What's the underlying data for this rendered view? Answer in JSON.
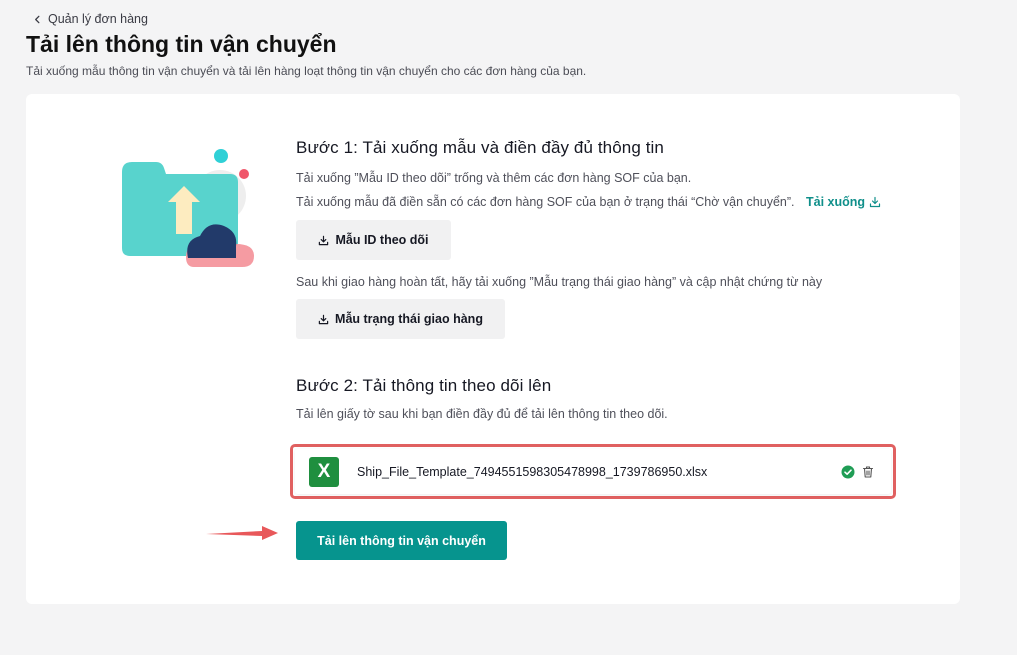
{
  "breadcrumb": {
    "label": "Quản lý đơn hàng"
  },
  "page": {
    "title": "Tải lên thông tin vận chuyển",
    "subtitle": "Tải xuống mẫu thông tin vận chuyển và tải lên hàng loạt thông tin vận chuyển cho các đơn hàng của bạn."
  },
  "step1": {
    "title": "Bước 1: Tải xuống mẫu và điền đầy đủ thông tin",
    "desc1": "Tải xuống ”Mẫu ID theo dõi” trống và thêm các đơn hàng SOF của bạn.",
    "desc2": "Tải xuống mẫu đã điền sẵn có các đơn hàng SOF của bạn ở trạng thái “Chờ vận chuyển”.",
    "download_link": "Tải xuống",
    "tracking_template_button": "Mẫu ID theo dõi",
    "desc3": "Sau khi giao hàng hoàn tất, hãy tải xuống ”Mẫu trạng thái giao hàng” và cập nhật chứng từ này",
    "delivery_template_button": "Mẫu trạng thái giao hàng"
  },
  "step2": {
    "title": "Bước 2: Tải thông tin theo dõi lên",
    "desc": "Tải lên giấy tờ sau khi bạn điền đầy đủ để tải lên thông tin theo dõi.",
    "file": {
      "icon_letter": "X",
      "name": "Ship_File_Template_7494551598305478998_1739786950.xlsx",
      "status": "uploaded"
    },
    "upload_button": "Tải lên thông tin vận chuyển"
  },
  "colors": {
    "accent": "#06948e",
    "link": "#0f8f8a",
    "highlight_border": "#e06060",
    "success": "#1f9d55",
    "excel": "#1f8f3f"
  },
  "icons": {
    "back": "chevron-left-icon",
    "download": "download-icon",
    "file": "excel-file-icon",
    "success": "check-circle-icon",
    "delete": "trash-icon",
    "illustration": "folder-upload-illustration",
    "pointer": "red-arrow-icon"
  }
}
